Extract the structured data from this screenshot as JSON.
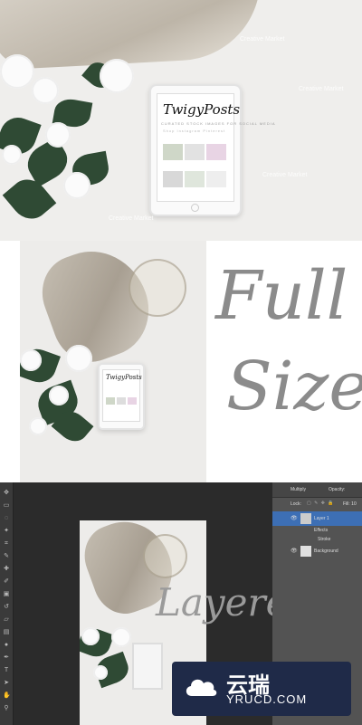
{
  "section1": {
    "tablet_title": "TwigyPosts",
    "tablet_subtitle": "CURATED STOCK IMAGES FOR SOCIAL MEDIA",
    "tablet_nav": "Shop  Instagram  Pinterest",
    "watermark": "Creative Market"
  },
  "section2": {
    "heading_line1": "Full",
    "heading_line2": "Size",
    "tablet_title": "TwigyPosts"
  },
  "section3": {
    "canvas_script": "Layered",
    "panel": {
      "blend_mode": "Multiply",
      "opacity_label": "Opacity:",
      "lock_label": "Lock:",
      "fill_label": "Fill: 10",
      "layers": [
        {
          "name": "Layer 1"
        },
        {
          "name": "Effects"
        },
        {
          "name": "Stroke"
        },
        {
          "name": "Background"
        }
      ]
    }
  },
  "banner": {
    "cn_text": "云瑞",
    "en_text": "YRUCD.COM",
    "bg_color": "#1f2a48"
  }
}
